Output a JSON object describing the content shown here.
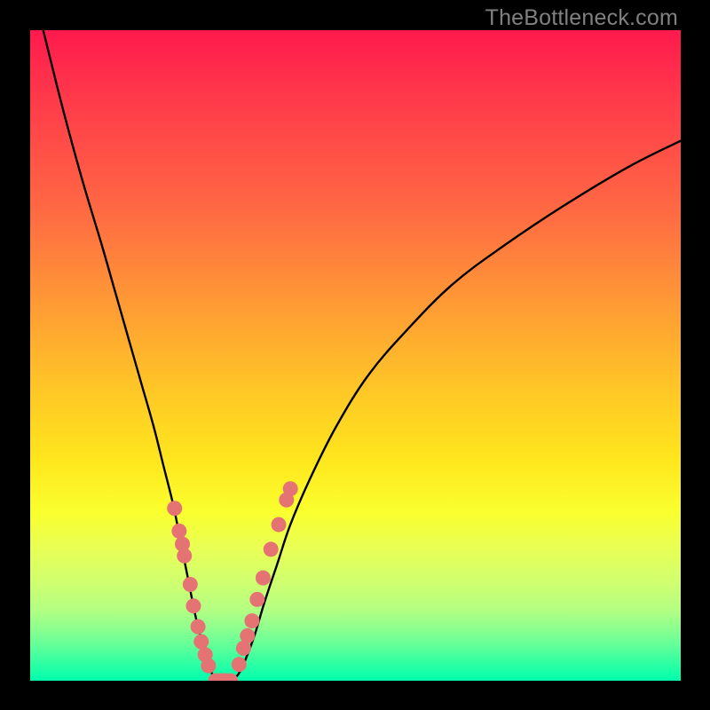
{
  "watermark": "TheBottleneck.com",
  "chart_data": {
    "type": "line",
    "title": "",
    "xlabel": "",
    "ylabel": "",
    "xlim": [
      0,
      100
    ],
    "ylim": [
      0,
      100
    ],
    "series": [
      {
        "name": "curve-left",
        "x": [
          2,
          5,
          8,
          11,
          13,
          15,
          17,
          19,
          20.5,
          22,
          23.2,
          24.4,
          25.4,
          26.4,
          27.2,
          28,
          28.8
        ],
        "y": [
          100,
          88,
          77,
          67,
          60,
          53,
          46,
          39,
          33,
          27,
          21,
          15,
          10,
          6,
          3,
          1,
          0
        ]
      },
      {
        "name": "curve-right",
        "x": [
          31,
          32,
          33,
          34.5,
          36,
          38,
          40,
          43,
          47,
          52,
          58,
          65,
          73,
          82,
          92,
          100
        ],
        "y": [
          0,
          1,
          3,
          7,
          12,
          18,
          24,
          31,
          39,
          47,
          54,
          61,
          67,
          73,
          79,
          83
        ]
      },
      {
        "name": "curve-flat",
        "x": [
          28.8,
          29.5,
          30.2,
          31
        ],
        "y": [
          0,
          0,
          0,
          0
        ]
      }
    ],
    "dots_left": [
      {
        "x": 22.2,
        "y": 26.5
      },
      {
        "x": 22.9,
        "y": 23.0
      },
      {
        "x": 23.7,
        "y": 19.2
      },
      {
        "x": 23.4,
        "y": 21.0
      },
      {
        "x": 24.6,
        "y": 14.8
      },
      {
        "x": 25.1,
        "y": 11.5
      },
      {
        "x": 25.8,
        "y": 8.3
      },
      {
        "x": 26.3,
        "y": 6.0
      },
      {
        "x": 26.9,
        "y": 4.0
      },
      {
        "x": 27.4,
        "y": 2.3
      }
    ],
    "dots_flat": [
      {
        "x": 28.5,
        "y": 0.0
      },
      {
        "x": 29.3,
        "y": 0.0
      },
      {
        "x": 30.0,
        "y": 0.0
      },
      {
        "x": 30.8,
        "y": 0.0
      }
    ],
    "dots_right": [
      {
        "x": 32.1,
        "y": 2.5
      },
      {
        "x": 32.8,
        "y": 5.0
      },
      {
        "x": 33.4,
        "y": 6.9
      },
      {
        "x": 34.1,
        "y": 9.2
      },
      {
        "x": 34.9,
        "y": 12.5
      },
      {
        "x": 35.8,
        "y": 15.8
      },
      {
        "x": 37.0,
        "y": 20.2
      },
      {
        "x": 38.2,
        "y": 24.0
      },
      {
        "x": 39.4,
        "y": 27.8
      },
      {
        "x": 40.0,
        "y": 29.5
      }
    ],
    "dot_color": "#e57373",
    "dot_radius_px": 8.5
  }
}
